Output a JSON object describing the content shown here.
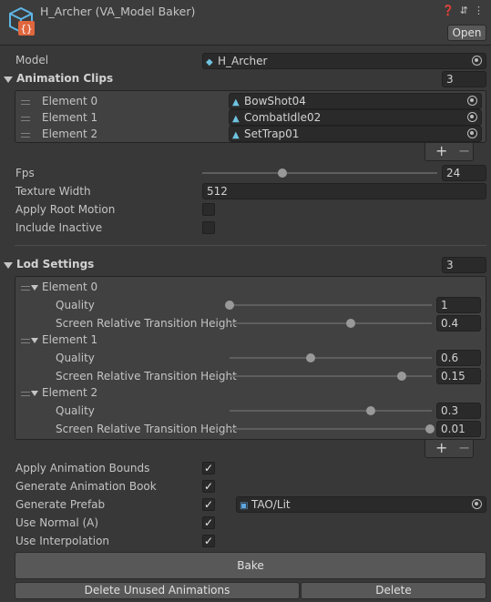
{
  "header": {
    "title": "H_Archer (VA_Model Baker)",
    "open_label": "Open",
    "icons": [
      "help-icon",
      "settings-sliders-icon",
      "more-icon"
    ]
  },
  "model": {
    "label": "Model",
    "value": "H_Archer"
  },
  "animation_clips": {
    "label": "Animation Clips",
    "size": "3",
    "items": [
      {
        "label": "Element 0",
        "value": "BowShot04"
      },
      {
        "label": "Element 1",
        "value": "CombatIdle02"
      },
      {
        "label": "Element 2",
        "value": "SetTrap01"
      }
    ],
    "add": "+",
    "remove": "−"
  },
  "fps": {
    "label": "Fps",
    "value": "24",
    "fraction": 0.342
  },
  "texture_width": {
    "label": "Texture Width",
    "value": "512"
  },
  "apply_root_motion": {
    "label": "Apply Root Motion",
    "checked": false
  },
  "include_inactive": {
    "label": "Include Inactive",
    "checked": false
  },
  "lod_settings": {
    "label": "Lod Settings",
    "size": "3",
    "quality_label": "Quality",
    "screen_label": "Screen Relative Transition Height",
    "elements": [
      {
        "label": "Element 0",
        "quality": "1",
        "screen": "0.4"
      },
      {
        "label": "Element 1",
        "quality": "0.6",
        "screen": "0.15"
      },
      {
        "label": "Element 2",
        "quality": "0.3",
        "screen": "0.01"
      }
    ],
    "add": "+",
    "remove": "−"
  },
  "apply_animation_bounds": {
    "label": "Apply Animation Bounds",
    "checked": true
  },
  "generate_animation_book": {
    "label": "Generate Animation Book",
    "checked": true
  },
  "generate_prefab": {
    "label": "Generate Prefab",
    "checked": true,
    "material": "TAO/Lit"
  },
  "use_normal": {
    "label": "Use Normal (A)",
    "checked": true
  },
  "use_interpolation": {
    "label": "Use Interpolation",
    "checked": true
  },
  "buttons": {
    "bake": "Bake",
    "delete_unused": "Delete Unused Animations",
    "delete": "Delete"
  },
  "checkmark": "✓"
}
